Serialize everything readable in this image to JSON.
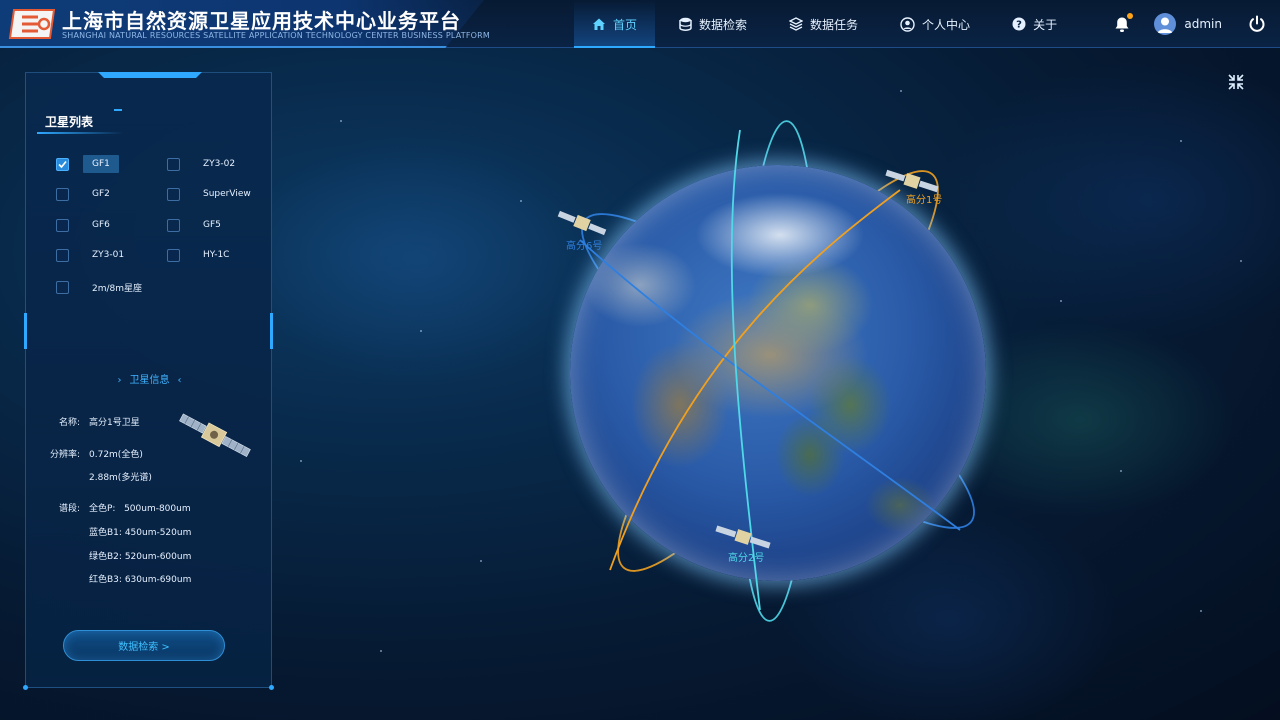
{
  "header": {
    "title_cn": "上海市自然资源卫星应用技术中心业务平台",
    "title_en": "SHANGHAI NATURAL RESOURCES SATELLITE APPLICATION TECHNOLOGY CENTER BUSINESS PLATFORM",
    "nav": [
      {
        "label": "首页",
        "icon": "home-icon",
        "active": true
      },
      {
        "label": "数据检索",
        "icon": "database-icon",
        "active": false
      },
      {
        "label": "数据任务",
        "icon": "layers-icon",
        "active": false
      },
      {
        "label": "个人中心",
        "icon": "user-icon",
        "active": false
      },
      {
        "label": "关于",
        "icon": "help-icon",
        "active": false
      }
    ],
    "username": "admin"
  },
  "panel": {
    "title": "卫星列表",
    "satellites": [
      {
        "label": "GF1",
        "checked": true
      },
      {
        "label": "ZY3-02",
        "checked": false
      },
      {
        "label": "GF2",
        "checked": false
      },
      {
        "label": "SuperView",
        "checked": false
      },
      {
        "label": "GF6",
        "checked": false
      },
      {
        "label": "GF5",
        "checked": false
      },
      {
        "label": "ZY3-01",
        "checked": false
      },
      {
        "label": "HY-1C",
        "checked": false
      },
      {
        "label": "2m/8m星座",
        "checked": false
      }
    ],
    "info_title": "卫星信息",
    "info": {
      "name_key": "名称:",
      "name_val": "高分1号卫星",
      "res_key": "分辨率:",
      "res_val1": "0.72m(全色)",
      "res_val2": "2.88m(多光谱)",
      "band_key": "谱段:",
      "bands": [
        {
          "name": "全色P:",
          "range": "500um-800um"
        },
        {
          "name": "蓝色B1:",
          "range": "450um-520um"
        },
        {
          "name": "绿色B2:",
          "range": "520um-600um"
        },
        {
          "name": "红色B3:",
          "range": "630um-690um"
        }
      ]
    },
    "search_button": "数据检索 >"
  },
  "globe": {
    "satellites": [
      {
        "label": "高分6号",
        "color": "#2f7fe0"
      },
      {
        "label": "高分1号",
        "color": "#f0a020"
      },
      {
        "label": "高分2号",
        "color": "#4fd8e8"
      }
    ]
  },
  "colors": {
    "accent": "#2fa8ff",
    "orbit_blue": "#2f7fe0",
    "orbit_orange": "#f0a020",
    "orbit_cyan": "#4fd8e8"
  }
}
